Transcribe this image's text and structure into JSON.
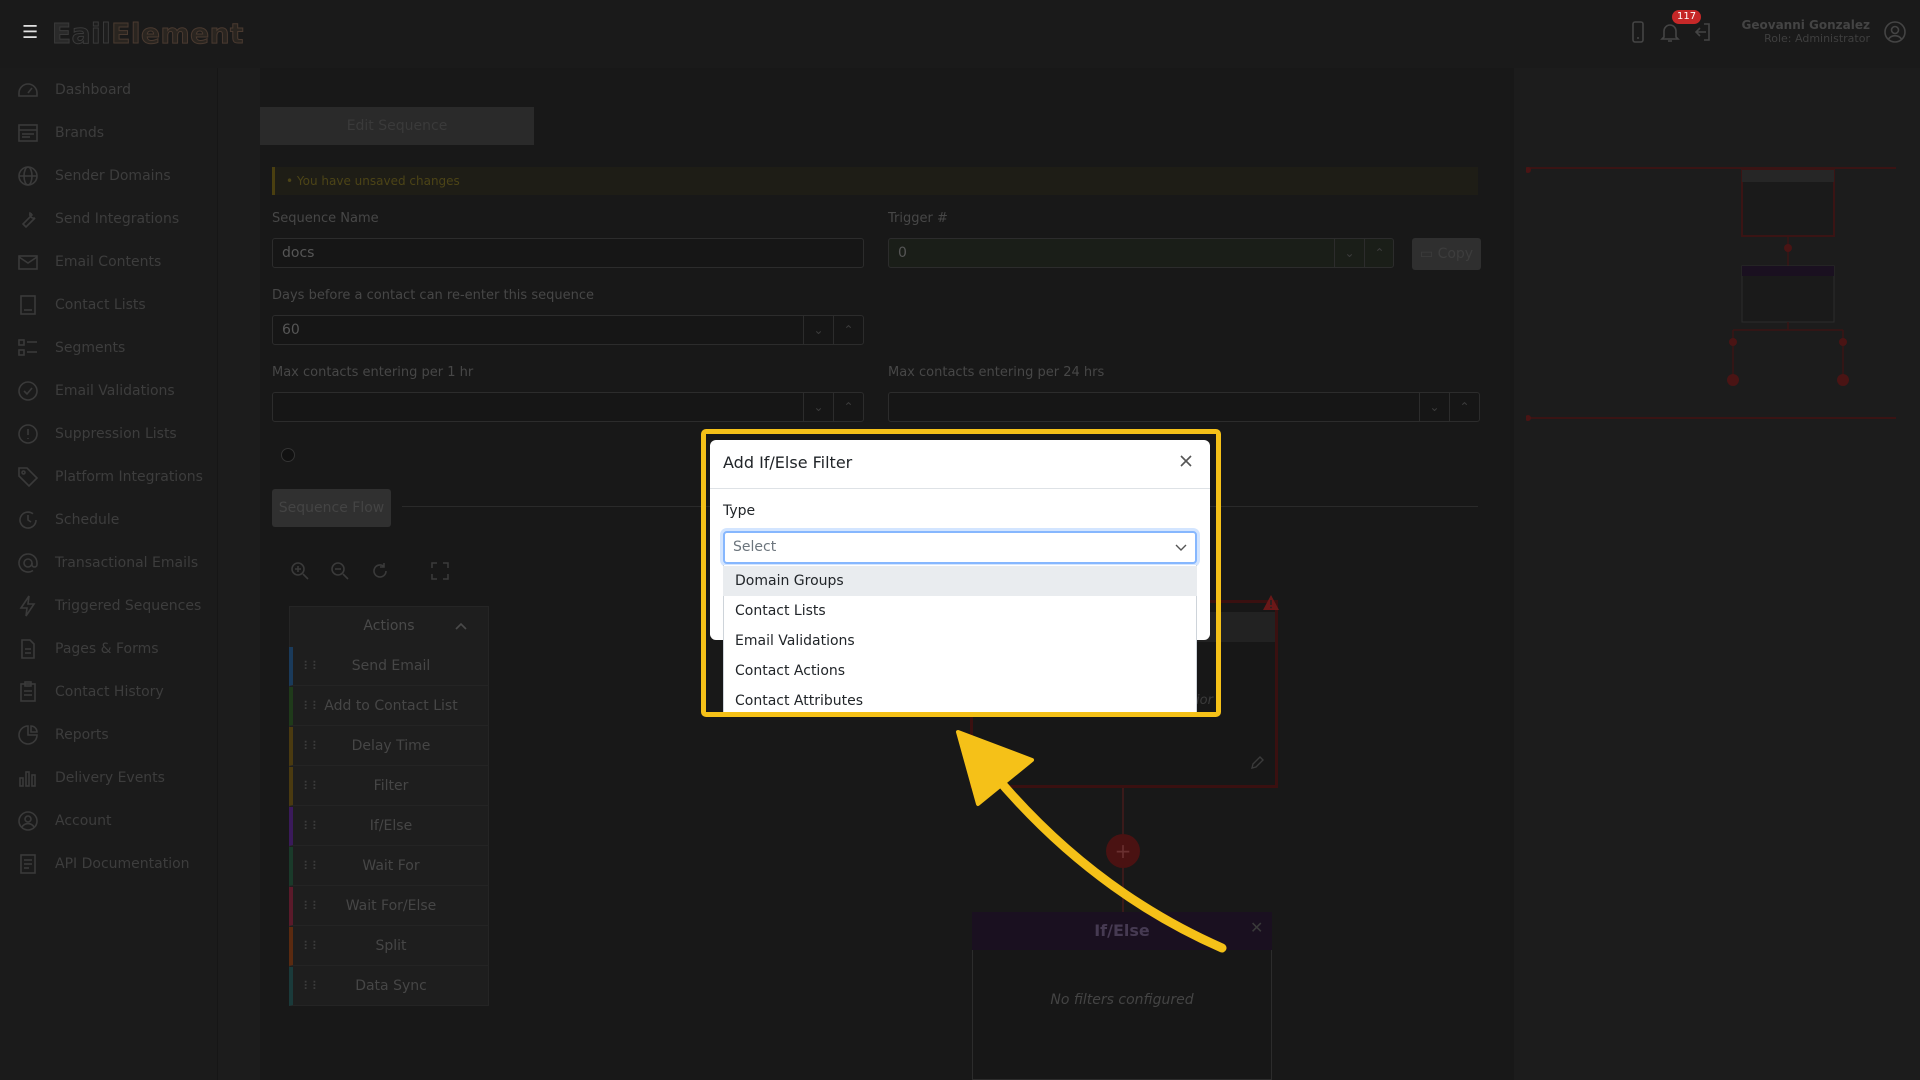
{
  "app": {
    "logo_part1": "E",
    "logo_part2": "ail",
    "logo_part3": "Element"
  },
  "header": {
    "notifications_count": "117",
    "user_name": "Geovanni Gonzalez",
    "user_role": "Role: Administrator"
  },
  "sidebar": {
    "items": [
      {
        "label": "Dashboard",
        "icon": "dashboard-icon"
      },
      {
        "label": "Brands",
        "icon": "brands-icon"
      },
      {
        "label": "Sender Domains",
        "icon": "globe-icon"
      },
      {
        "label": "Send Integrations",
        "icon": "wrench-icon"
      },
      {
        "label": "Email Contents",
        "icon": "envelope-icon"
      },
      {
        "label": "Contact Lists",
        "icon": "contact-list-icon"
      },
      {
        "label": "Segments",
        "icon": "segments-icon"
      },
      {
        "label": "Email Validations",
        "icon": "check-circle-icon"
      },
      {
        "label": "Suppression Lists",
        "icon": "exclamation-circle-icon"
      },
      {
        "label": "Platform Integrations",
        "icon": "tag-icon"
      },
      {
        "label": "Schedule",
        "icon": "schedule-icon"
      },
      {
        "label": "Transactional Emails",
        "icon": "at-icon"
      },
      {
        "label": "Triggered Sequences",
        "icon": "lightning-icon"
      },
      {
        "label": "Pages & Forms",
        "icon": "page-icon"
      },
      {
        "label": "Contact History",
        "icon": "history-icon"
      },
      {
        "label": "Reports",
        "icon": "pie-chart-icon"
      },
      {
        "label": "Delivery Events",
        "icon": "bar-chart-icon"
      },
      {
        "label": "Account",
        "icon": "account-icon"
      },
      {
        "label": "API Documentation",
        "icon": "document-icon"
      }
    ]
  },
  "editor": {
    "tab_label": "Edit Sequence",
    "unsaved_warning": "You have unsaved changes",
    "sequence_name_label": "Sequence Name",
    "sequence_name_value": "docs",
    "trigger_label": "Trigger #",
    "trigger_value": "0",
    "copy_label": "Copy",
    "reenter_label": "Days before a contact can re-enter this sequence",
    "reenter_value": "60",
    "max_1hr_label": "Max contacts entering per 1 hr",
    "max_24hr_label": "Max contacts entering per 24 hrs",
    "sequence_flow_label": "Sequence Flow"
  },
  "actions": {
    "title": "Actions",
    "items": [
      {
        "label": "Send Email",
        "color": "#1a3a5a"
      },
      {
        "label": "Add to Contact List",
        "color": "#1f3a1a"
      },
      {
        "label": "Delay Time",
        "color": "#4a3a10"
      },
      {
        "label": "Filter",
        "color": "#4a3a10"
      },
      {
        "label": "If/Else",
        "color": "#3a1a5a"
      },
      {
        "label": "Wait For",
        "color": "#1a3a2a"
      },
      {
        "label": "Wait For/Else",
        "color": "#5a1a2a"
      },
      {
        "label": "Split",
        "color": "#5a2a10"
      },
      {
        "label": "Data Sync",
        "color": "#1a3a3a"
      }
    ]
  },
  "canvas": {
    "ifelse_title": "If/Else",
    "no_filters": "No filters configured",
    "partial_text": "ior"
  },
  "modal": {
    "title": "Add If/Else Filter",
    "type_label": "Type",
    "select_placeholder": "Select",
    "options": [
      "Domain Groups",
      "Contact Lists",
      "Email Validations",
      "Contact Actions",
      "Contact Attributes"
    ],
    "active_option": "Domain Groups"
  },
  "colors": {
    "highlight": "#f5c118",
    "focus_border": "#86b7fe"
  }
}
